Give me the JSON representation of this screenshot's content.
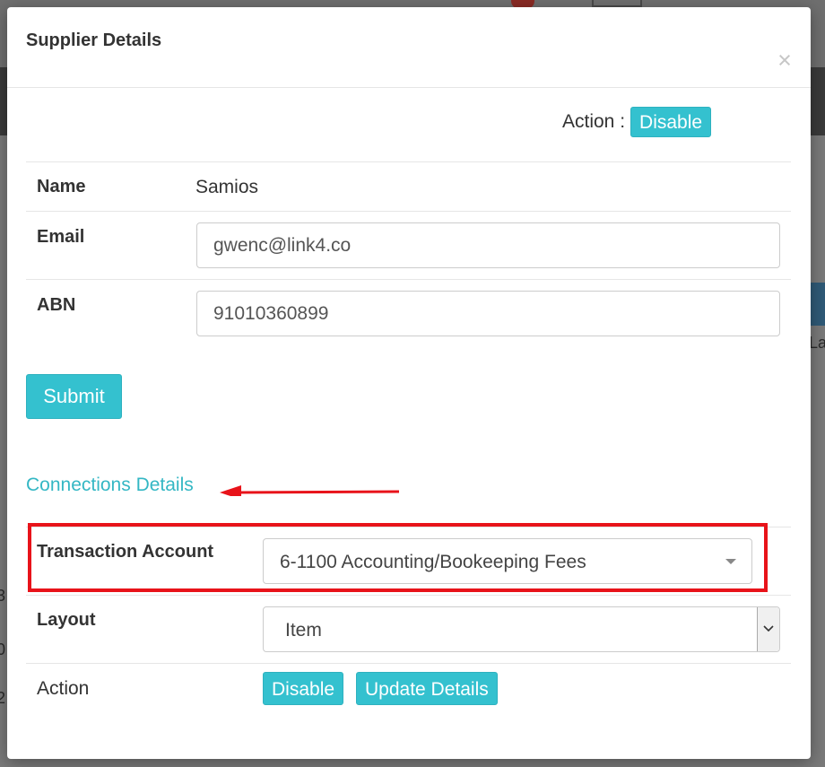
{
  "background": {
    "fragments": [
      "La",
      "3",
      "0",
      "2"
    ]
  },
  "modal": {
    "title": "Supplier Details",
    "close_symbol": "×",
    "action_label": "Action :",
    "action_button": "Disable"
  },
  "details": {
    "name_label": "Name",
    "name_value": "Samios",
    "email_label": "Email",
    "email_value": "gwenc@link4.co",
    "abn_label": "ABN",
    "abn_value": "91010360899"
  },
  "submit_label": "Submit",
  "connections": {
    "section_title": "Connections Details",
    "transaction_account_label": "Transaction Account",
    "transaction_account_value": "6-1100 Accounting/Bookeeping Fees",
    "layout_label": "Layout",
    "layout_value": "Item",
    "action_label": "Action",
    "disable_button": "Disable",
    "update_button": "Update Details"
  },
  "colors": {
    "accent": "#34c1cf",
    "section_title": "#34b7c4",
    "highlight": "#e8131a"
  }
}
